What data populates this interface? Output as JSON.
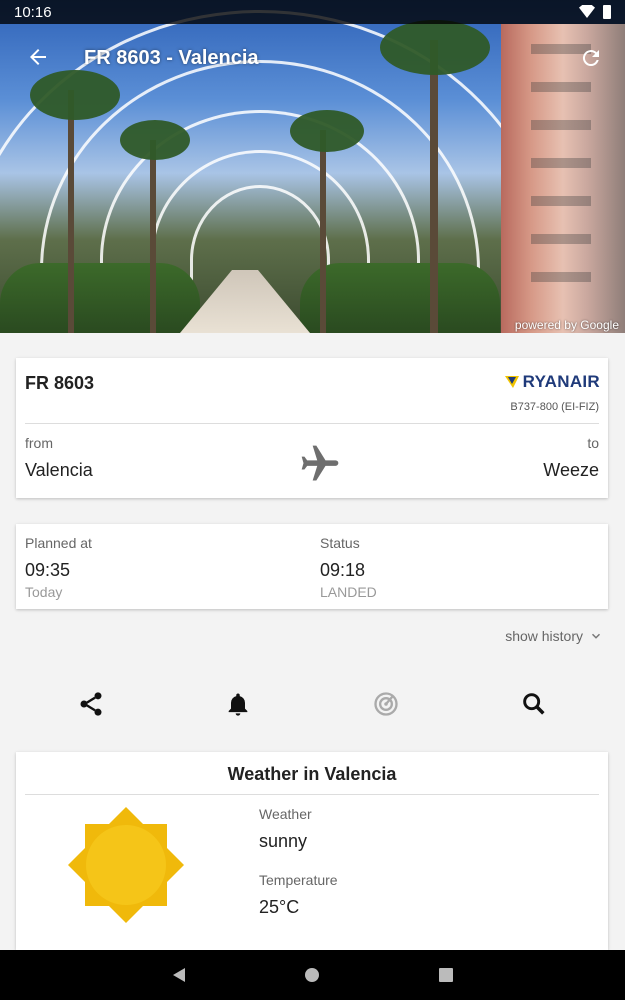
{
  "status_bar": {
    "time": "10:16"
  },
  "toolbar": {
    "title": "FR 8603 - Valencia"
  },
  "hero": {
    "credit": "powered by Google"
  },
  "flight": {
    "number": "FR 8603",
    "airline": "RYANAIR",
    "aircraft": "B737-800  (EI-FIZ)",
    "from_label": "from",
    "from_city": "Valencia",
    "to_label": "to",
    "to_city": "Weeze"
  },
  "schedule": {
    "planned_label": "Planned at",
    "planned_time": "09:35",
    "planned_day": "Today",
    "status_label": "Status",
    "status_time": "09:18",
    "status_text": "LANDED"
  },
  "history": {
    "label": "show history"
  },
  "actions": [
    "share-icon",
    "bell-icon",
    "radar-icon",
    "search-icon"
  ],
  "weather": {
    "title": "Weather in Valencia",
    "weather_label": "Weather",
    "weather_value": "sunny",
    "temp_label": "Temperature",
    "temp_value": "25°C"
  },
  "colors": {
    "airline_blue": "#1f3a7a",
    "airline_yellow": "#f1c400",
    "sun": "#f5c518"
  }
}
